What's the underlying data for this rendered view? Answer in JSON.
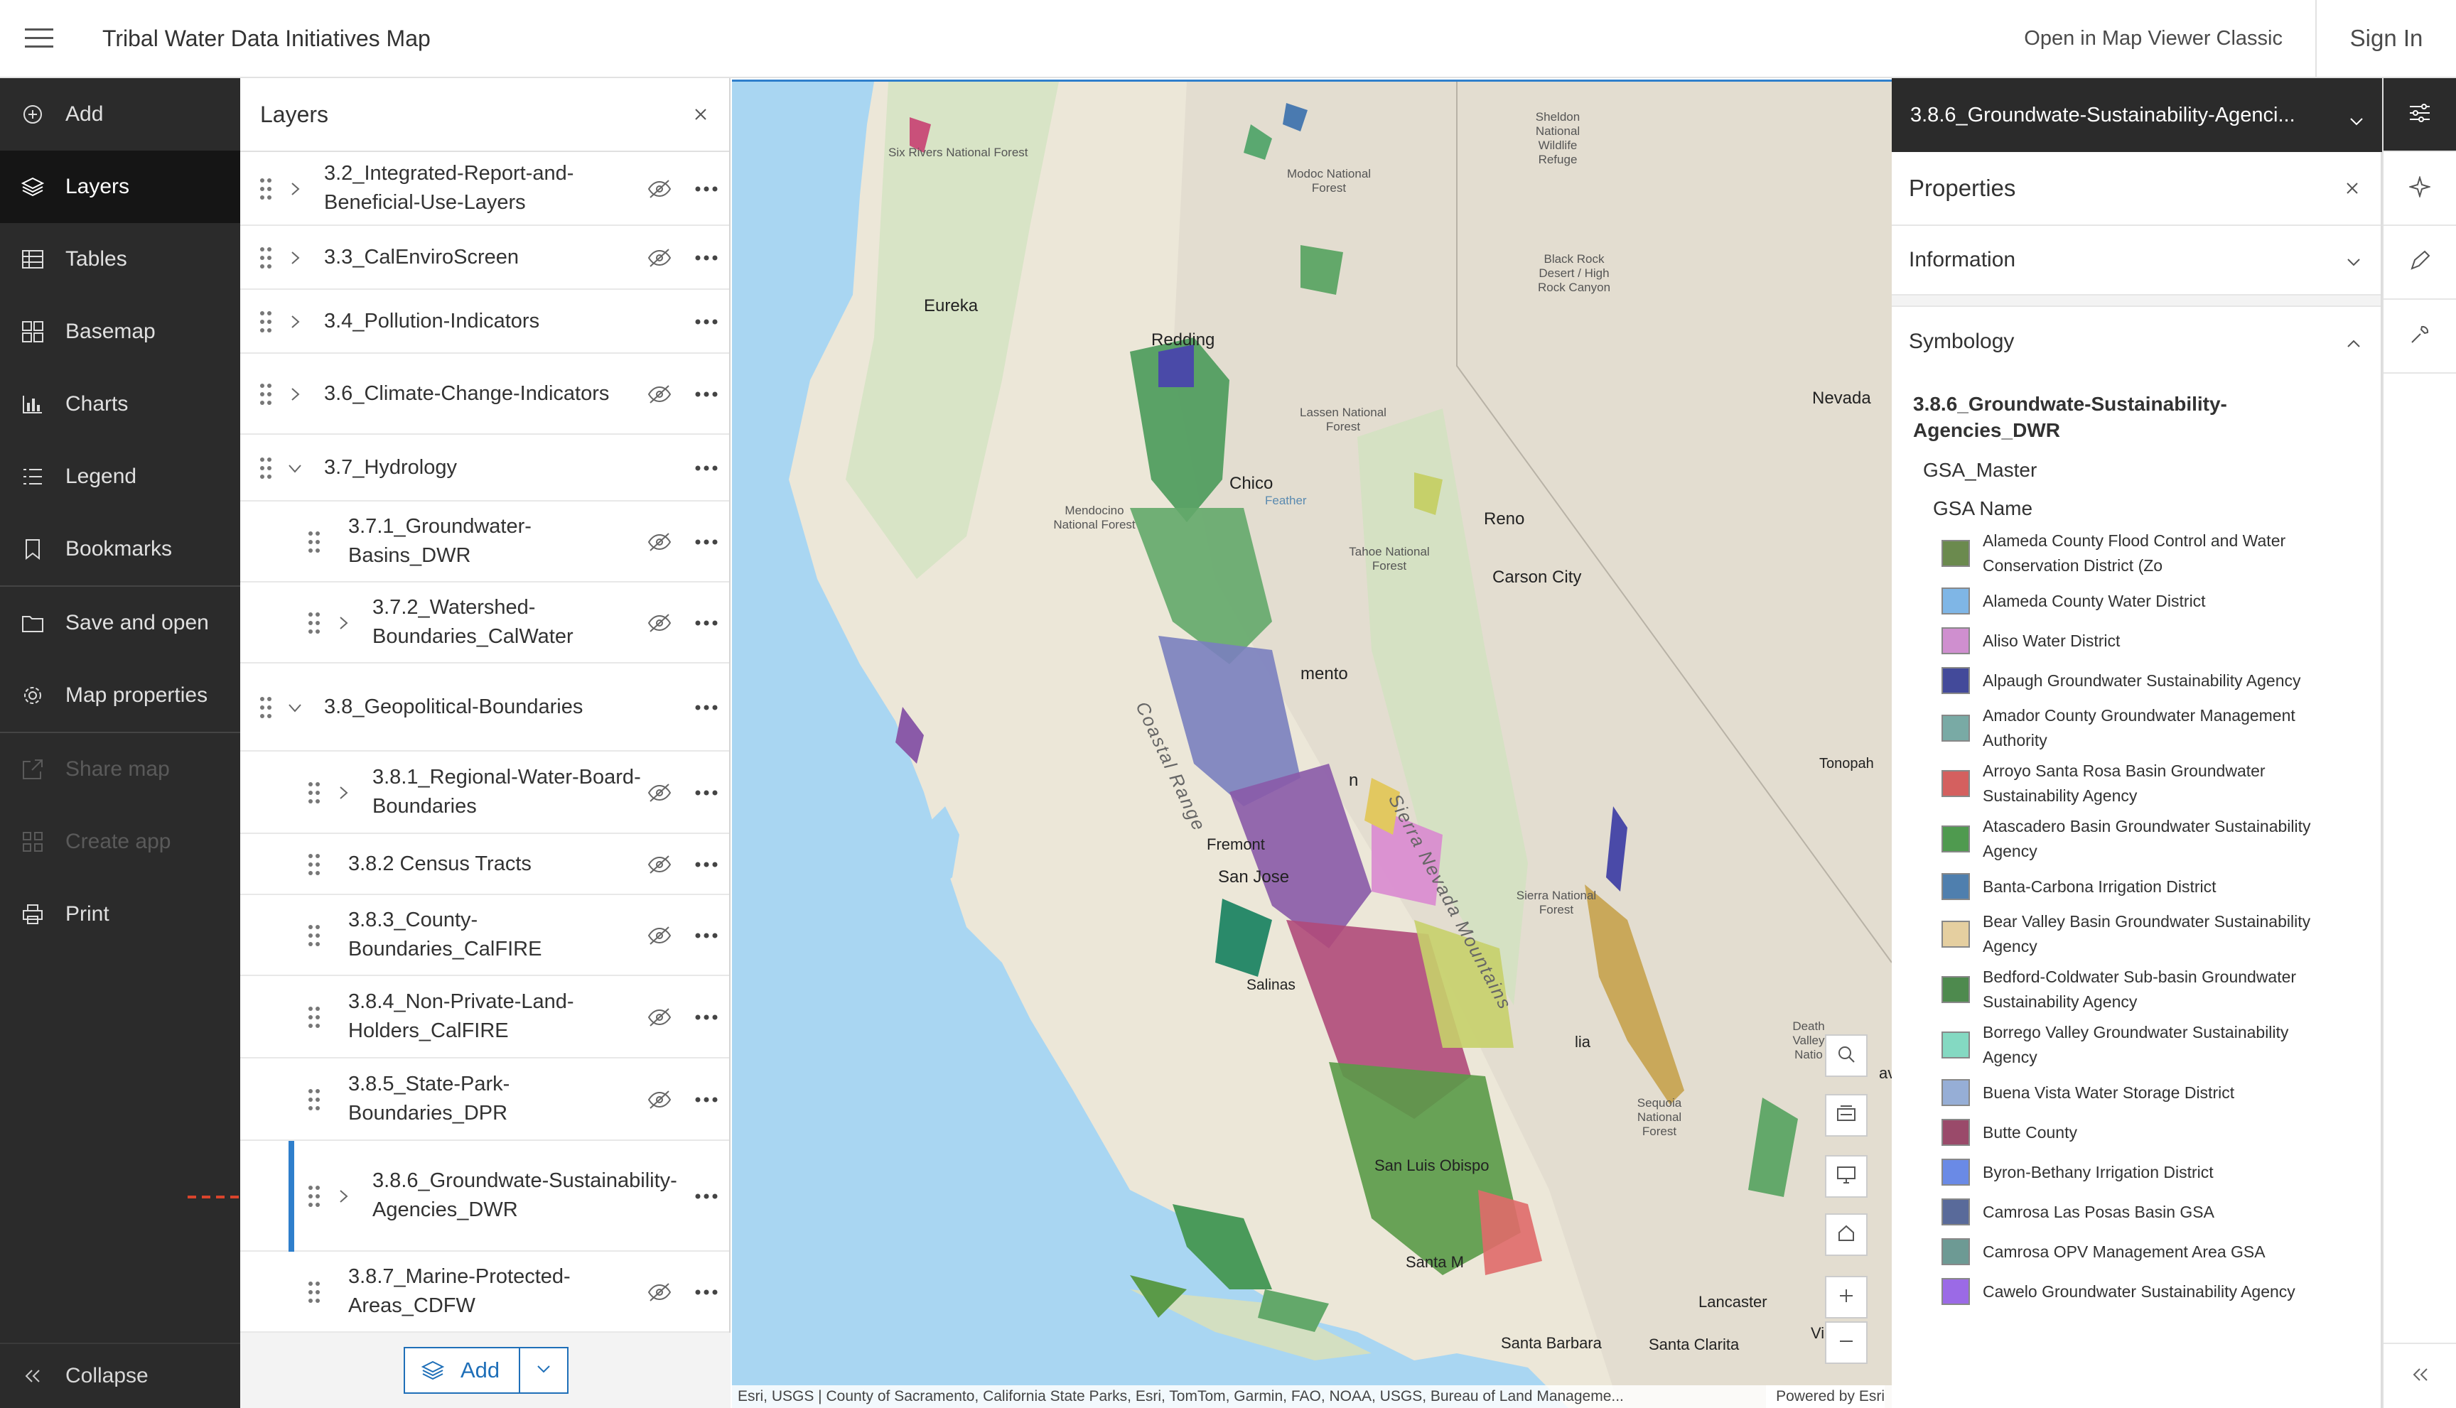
{
  "header": {
    "title": "Tribal Water Data Initiatives Map",
    "open_classic": "Open in Map Viewer Classic",
    "sign_in": "Sign In"
  },
  "actionbar": {
    "items": [
      {
        "label": "Add",
        "icon": "plus-circle-icon"
      },
      {
        "label": "Layers",
        "icon": "layers-icon",
        "active": true
      },
      {
        "label": "Tables",
        "icon": "table-icon"
      },
      {
        "label": "Basemap",
        "icon": "basemap-icon"
      },
      {
        "label": "Charts",
        "icon": "chart-icon"
      },
      {
        "label": "Legend",
        "icon": "legend-icon"
      },
      {
        "label": "Bookmarks",
        "icon": "bookmark-icon"
      },
      {
        "label": "Save and open",
        "icon": "folder-icon"
      },
      {
        "label": "Map properties",
        "icon": "gear-icon"
      },
      {
        "label": "Share map",
        "icon": "share-icon",
        "disabled": true
      },
      {
        "label": "Create app",
        "icon": "apps-icon",
        "disabled": true
      },
      {
        "label": "Print",
        "icon": "print-icon"
      }
    ],
    "collapse": "Collapse"
  },
  "layers": {
    "title": "Layers",
    "rows": [
      {
        "label": "3.2_Integrated-Report-and-Beneficial-Use-Layers"
      },
      {
        "label": "3.3_CalEnviroScreen"
      },
      {
        "label": "3.4_Pollution-Indicators"
      },
      {
        "label": "3.6_Climate-Change-Indicators"
      },
      {
        "label": "3.7_Hydrology"
      },
      {
        "label": "3.7.1_Groundwater-Basins_DWR"
      },
      {
        "label": "3.7.2_Watershed-Boundaries_CalWater"
      },
      {
        "label": "3.8_Geopolitical-Boundaries"
      },
      {
        "label": "3.8.1_Regional-Water-Board-Boundaries"
      },
      {
        "label": "3.8.2 Census Tracts"
      },
      {
        "label": "3.8.3_County-Boundaries_CalFIRE"
      },
      {
        "label": "3.8.4_Non-Private-Land-Holders_CalFIRE"
      },
      {
        "label": "3.8.5_State-Park-Boundaries_DPR"
      },
      {
        "label": "3.8.6_Groundwate-Sustainability-Agencies_DWR"
      },
      {
        "label": "3.8.7_Marine-Protected-Areas_CDFW"
      }
    ],
    "add_label": "Add"
  },
  "map": {
    "labels": {
      "six_rivers": "Six Rivers National Forest",
      "modoc": "Modoc National Forest",
      "sheldon": "Sheldon National Wildlife Refuge",
      "black_rock": "Black Rock Desert / High Rock Canyon",
      "eureka": "Eureka",
      "redding": "Redding",
      "lassen": "Lassen National Forest",
      "nevada": "Nevada",
      "chico": "Chico",
      "mendocino": "Mendocino National Forest",
      "feather": "Feather",
      "reno": "Reno",
      "tahoe": "Tahoe National Forest",
      "carson": "Carson City",
      "sacramento": "mento",
      "sierra_mtns": "Sierra Nevada Mountains",
      "coastal_range": "Coastal Range",
      "tonopah": "Tonopah",
      "fremont": "Fremont",
      "san_jose": "San Jose",
      "sierra_nf": "Sierra National Forest",
      "salinas": "Salinas",
      "death_valley": "Death Valley Natio",
      "sequoia": "Sequoia National Forest",
      "slo": "San Luis Obispo",
      "santa_maria": "Santa M",
      "lancaster": "Lancaster",
      "santa_barbara": "Santa Barbara",
      "santa_clarita": "Santa Clarita",
      "vic": "Vic",
      "ave": "ave",
      "n": "n",
      "lia": "lia"
    },
    "attribution": "Esri, USGS | County of Sacramento, California State Parks, Esri, TomTom, Garmin, FAO, NOAA, USGS, Bureau of Land Manageme...",
    "powered": "Powered by Esri"
  },
  "properties": {
    "layer_select": "3.8.6_Groundwate-Sustainability-Agenci...",
    "title": "Properties",
    "information": "Information",
    "symbology": "Symbology",
    "layer_name": "3.8.6_Groundwate-Sustainability-Agencies_DWR",
    "field": "GSA_Master",
    "sub": "GSA Name",
    "items": [
      {
        "label": "Alameda County Flood Control and Water Conservation District (Zo",
        "color": "#6b8a4e"
      },
      {
        "label": "Alameda County Water District",
        "color": "#7fb6e6"
      },
      {
        "label": "Aliso Water District",
        "color": "#cf8fcf"
      },
      {
        "label": "Alpaugh Groundwater Sustainability Agency",
        "color": "#434a9a"
      },
      {
        "label": "Amador County Groundwater Management Authority",
        "color": "#79aaa5"
      },
      {
        "label": "Arroyo Santa Rosa Basin Groundwater Sustainability Agency",
        "color": "#d4605f"
      },
      {
        "label": "Atascadero Basin Groundwater Sustainability Agency",
        "color": "#4f9a4f"
      },
      {
        "label": "Banta-Carbona Irrigation District",
        "color": "#4f7fae"
      },
      {
        "label": "Bear Valley Basin Groundwater Sustainability Agency",
        "color": "#e5cfa0"
      },
      {
        "label": "Bedford-Coldwater Sub-basin Groundwater Sustainability Agency",
        "color": "#4e8a4e"
      },
      {
        "label": "Borrego Valley Groundwater Sustainability Agency",
        "color": "#84d9c2"
      },
      {
        "label": "Buena Vista Water Storage District",
        "color": "#96aed6"
      },
      {
        "label": "Butte County",
        "color": "#9a4a6a"
      },
      {
        "label": "Byron-Bethany Irrigation District",
        "color": "#6a8ae6"
      },
      {
        "label": "Camrosa Las Posas Basin GSA",
        "color": "#596a9a"
      },
      {
        "label": "Camrosa OPV Management Area GSA",
        "color": "#6d9a94"
      },
      {
        "label": "Cawelo Groundwater Sustainability Agency",
        "color": "#9b6ae6"
      }
    ]
  },
  "tools": [
    {
      "icon": "sliders-icon",
      "active": true
    },
    {
      "icon": "sparkle-icon"
    },
    {
      "icon": "pen-icon"
    },
    {
      "icon": "wrench-icon"
    }
  ]
}
